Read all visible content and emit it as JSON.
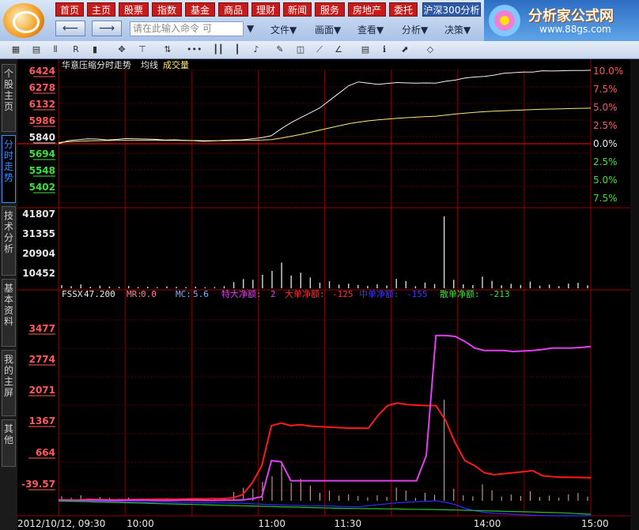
{
  "nav": {
    "row1": [
      "首页",
      "主页",
      "股票",
      "指数",
      "基金",
      "商品",
      "理财",
      "新闻",
      "服务",
      "房地产",
      "委托"
    ],
    "index_btn": "沪深300分析",
    "command_placeholder": "请在此输入命令  可",
    "menus": [
      "文件▼",
      "画面▼",
      "查看▼",
      "分析▼",
      "决策▼"
    ]
  },
  "brand": {
    "name": "分析家公式网",
    "url": "www.88gs.com"
  },
  "left_tabs": [
    "个股主页",
    "分时走势",
    "技术分析",
    "基本资料",
    "我的主屏",
    "其他"
  ],
  "chart_data": [
    {
      "type": "line",
      "title": "华意压缩分时走势",
      "legend": [
        "均线",
        "成交量"
      ],
      "price_ticks": [
        "6424",
        "6278",
        "6132",
        "5986",
        "5840",
        "5694",
        "5548",
        "5402"
      ],
      "pct_ticks": [
        "10.0%",
        "7.5%",
        "5.0%",
        "2.5%",
        "0.0%",
        "2.5%",
        "5.0%",
        "7.5%"
      ],
      "ylim": [
        5402,
        6424
      ],
      "base": 5840,
      "price_series": [
        5830,
        5855,
        5862,
        5870,
        5868,
        5860,
        5865,
        5872,
        5870,
        5868,
        5866,
        5860,
        5862,
        5858,
        5855,
        5850,
        5853,
        5858,
        5860,
        5862,
        5870,
        5880,
        5895,
        5950,
        6000,
        6040,
        6080,
        6120,
        6180,
        6240,
        6300,
        6330,
        6320,
        6310,
        6318,
        6325,
        6322,
        6320,
        6322,
        6320,
        6335,
        6345,
        6362,
        6370,
        6375,
        6385,
        6400,
        6405,
        6410,
        6410,
        6420,
        6418,
        6420,
        6422,
        6422,
        6424
      ],
      "avg_series": [
        5840,
        5846,
        5850,
        5853,
        5855,
        5856,
        5857,
        5858,
        5858,
        5858,
        5858,
        5857,
        5857,
        5856,
        5856,
        5855,
        5855,
        5855,
        5856,
        5857,
        5858,
        5860,
        5864,
        5875,
        5890,
        5905,
        5922,
        5940,
        5958,
        5975,
        5992,
        6005,
        6015,
        6023,
        6030,
        6036,
        6041,
        6046,
        6050,
        6053,
        6062,
        6070,
        6078,
        6084,
        6089,
        6093,
        6097,
        6100,
        6103,
        6106,
        6109,
        6111,
        6113,
        6115,
        6117,
        6118
      ]
    },
    {
      "type": "bar",
      "title": "成交量",
      "ticks": [
        "41807",
        "31355",
        "20904",
        "10452"
      ],
      "ylim": [
        0,
        41807
      ],
      "values": [
        1800,
        1200,
        2200,
        900,
        1500,
        1100,
        800,
        1300,
        700,
        900,
        600,
        1100,
        800,
        700,
        900,
        600,
        700,
        1200,
        3500,
        5200,
        4800,
        7600,
        9800,
        14500,
        7200,
        8800,
        6100,
        3200,
        4000,
        2100,
        2600,
        1900,
        1400,
        2200,
        1600,
        5300,
        4100,
        1200,
        3200,
        2400,
        40500,
        4800,
        2200,
        1800,
        6600,
        4200,
        1700,
        2500,
        1900,
        3800,
        1500,
        2100,
        1200,
        2600,
        3100,
        1700
      ]
    },
    {
      "type": "line",
      "title": "FSSX",
      "header": {
        "fssx": "47.200",
        "mr": "0.0",
        "mc": "5.6",
        "tdjm": "2",
        "ddjm": "-125",
        "zdjm": "-155",
        "sdjm": "-213"
      },
      "labels": {
        "mr": "MR:",
        "mc": "MC:",
        "tdjm": "特大净额:",
        "ddjm": "大单净额:",
        "zdjm": "中单净额:",
        "sdjm": "散单净额:"
      },
      "ticks": [
        "3477",
        "2774",
        "2071",
        "1367",
        "664",
        "-39.57"
      ],
      "ylim": [
        -300,
        3800
      ],
      "time_labels": [
        "2012/10/12, 09:30",
        "10:00",
        "11:00",
        "11:30",
        "14:00",
        "15:00"
      ],
      "series": [
        {
          "color": "#ff1a1a",
          "values": [
            20,
            15,
            10,
            30,
            25,
            20,
            18,
            22,
            25,
            28,
            30,
            32,
            30,
            35,
            40,
            38,
            42,
            45,
            60,
            120,
            350,
            700,
            1500,
            1550,
            1500,
            1520,
            1490,
            1480,
            1470,
            1460,
            1450,
            1450,
            1445,
            1700,
            1900,
            1950,
            1920,
            1910,
            1900,
            1900,
            1600,
            1150,
            800,
            700,
            560,
            520,
            540,
            560,
            580,
            600,
            500,
            480,
            470,
            470,
            465,
            460
          ]
        },
        {
          "color": "#e23ef2",
          "values": [
            10,
            8,
            6,
            12,
            10,
            8,
            6,
            10,
            12,
            10,
            8,
            6,
            8,
            10,
            12,
            8,
            6,
            10,
            12,
            15,
            40,
            80,
            800,
            780,
            400,
            400,
            400,
            400,
            400,
            400,
            400,
            400,
            400,
            400,
            400,
            400,
            400,
            400,
            900,
            3300,
            3300,
            3280,
            3180,
            3050,
            3000,
            3000,
            3000,
            2980,
            2990,
            3000,
            3020,
            3050,
            3050,
            3050,
            3060,
            3080
          ]
        },
        {
          "color": "#2d2dff",
          "values": [
            0,
            -5,
            -10,
            -8,
            -12,
            -15,
            -18,
            -20,
            -22,
            -25,
            -28,
            -30,
            -32,
            -35,
            -38,
            -40,
            -42,
            -45,
            -48,
            -50,
            -60,
            -70,
            -80,
            -85,
            -90,
            -95,
            -100,
            -100,
            -105,
            -110,
            -115,
            -120,
            -100,
            -80,
            -60,
            -40,
            -30,
            -20,
            -10,
            0,
            -30,
            -80,
            -150,
            -200,
            -230,
            -250,
            -260,
            -270,
            -280,
            -290,
            -295,
            -300,
            -300,
            -300,
            -300,
            -300
          ]
        },
        {
          "color": "#2fbf2f",
          "values": [
            -5,
            -10,
            -15,
            -20,
            -25,
            -30,
            -35,
            -40,
            -45,
            -50,
            -55,
            -60,
            -65,
            -70,
            -75,
            -80,
            -85,
            -90,
            -95,
            -100,
            -105,
            -110,
            -115,
            -120,
            -125,
            -130,
            -135,
            -140,
            -145,
            -150,
            -152,
            -155,
            -158,
            -160,
            -162,
            -165,
            -168,
            -170,
            -172,
            -175,
            -180,
            -185,
            -190,
            -195,
            -200,
            -205,
            -210,
            -215,
            -220,
            -225,
            -230,
            -235,
            -240,
            -250,
            -260,
            -270
          ]
        }
      ]
    }
  ]
}
